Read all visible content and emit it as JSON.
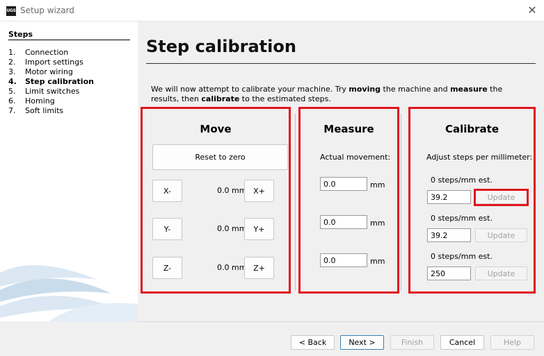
{
  "window": {
    "app_icon": "UGS",
    "title": "Setup wizard",
    "close_icon": "✕"
  },
  "sidebar": {
    "heading": "Steps",
    "steps": [
      {
        "num": "1.",
        "label": "Connection"
      },
      {
        "num": "2.",
        "label": "Import settings"
      },
      {
        "num": "3.",
        "label": "Motor wiring"
      },
      {
        "num": "4.",
        "label": "Step calibration"
      },
      {
        "num": "5.",
        "label": "Limit switches"
      },
      {
        "num": "6.",
        "label": "Homing"
      },
      {
        "num": "7.",
        "label": "Soft limits"
      }
    ]
  },
  "main": {
    "title": "Step calibration",
    "intro": {
      "p1": "We will now attempt to calibrate your machine. Try ",
      "b1": "moving",
      "p2": " the machine and ",
      "b2": "measure",
      "p3": " the results, then ",
      "b3": "calibrate",
      "p4": " to the estimated steps."
    },
    "move": {
      "title": "Move",
      "reset_label": "Reset to zero",
      "x_minus": "X-",
      "x_value": "0.0 mm",
      "x_plus": "X+",
      "y_minus": "Y-",
      "y_value": "0.0 mm",
      "y_plus": "Y+",
      "z_minus": "Z-",
      "z_value": "0.0 mm",
      "z_plus": "Z+"
    },
    "measure": {
      "title": "Measure",
      "label": "Actual movement:",
      "x_value": "0.0",
      "y_value": "0.0",
      "z_value": "0.0",
      "unit": "mm"
    },
    "calibrate": {
      "title": "Calibrate",
      "label": "Adjust steps per millimeter:",
      "x_est": "0 steps/mm est.",
      "x_value": "39.2",
      "y_est": "0 steps/mm est.",
      "y_value": "39.2",
      "z_est": "0 steps/mm est.",
      "z_value": "250",
      "update_label": "Update"
    }
  },
  "footer": {
    "back": "< Back",
    "next": "Next >",
    "finish": "Finish",
    "cancel": "Cancel",
    "help": "Help"
  },
  "colors": {
    "highlight": "#e0141e",
    "next_border": "#3c7fb1"
  }
}
